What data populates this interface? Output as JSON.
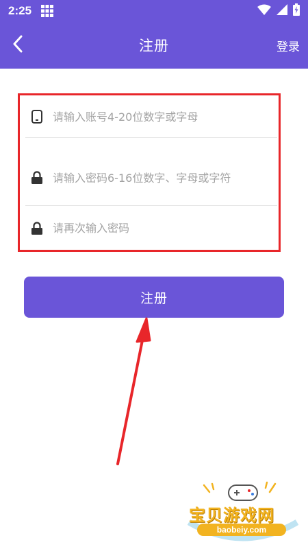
{
  "status_bar": {
    "time": "2:25"
  },
  "app_bar": {
    "title": "注册",
    "login_label": "登录"
  },
  "form": {
    "account_placeholder": "请输入账号4-20位数字或字母",
    "password_placeholder": "请输入密码6-16位数字、字母或字符",
    "confirm_placeholder": "请再次输入密码"
  },
  "register_button": {
    "label": "注册"
  },
  "watermark": {
    "name": "宝贝游戏网",
    "url": "baobeiy.com"
  },
  "colors": {
    "primary": "#6a55d8",
    "highlight_border": "#e8262a",
    "arrow": "#e8262a",
    "placeholder": "#a3a3a3"
  },
  "icons": [
    "grid-icon",
    "wifi-icon",
    "signal-icon",
    "battery-icon",
    "back-icon",
    "phone-icon",
    "lock-icon"
  ]
}
